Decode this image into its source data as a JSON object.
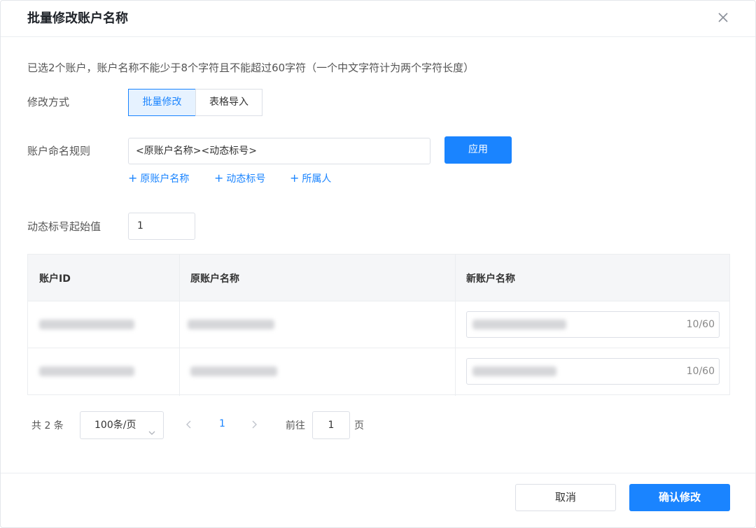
{
  "dialog": {
    "title": "批量修改账户名称",
    "close_icon": "close-icon"
  },
  "description": "已选2个账户，账户名称不能少于8个字符且不能超过60字符（一个中文字符计为两个字符长度）",
  "modify_mode": {
    "label": "修改方式",
    "options": [
      "批量修改",
      "表格导入"
    ],
    "selected": "批量修改"
  },
  "naming_rule": {
    "label": "账户命名规则",
    "value": "<原账户名称><动态标号>",
    "apply_label": "应用",
    "add_links": [
      {
        "plus": "+",
        "label": "原账户名称"
      },
      {
        "plus": "+",
        "label": "动态标号"
      },
      {
        "plus": "+",
        "label": "所属人"
      }
    ]
  },
  "start_value": {
    "label": "动态标号起始值",
    "value": "1"
  },
  "table": {
    "columns": [
      "账户ID",
      "原账户名称",
      "新账户名称"
    ],
    "rows": [
      {
        "new_name_count": "10/60"
      },
      {
        "new_name_count": "10/60"
      }
    ]
  },
  "pagination": {
    "total_text": "共 2 条",
    "page_size": "100条/页",
    "current_page": "1",
    "goto_label": "前往",
    "goto_value": "1",
    "page_suffix": "页"
  },
  "footer": {
    "cancel_label": "取消",
    "confirm_label": "确认修改"
  },
  "colors": {
    "primary": "#1a84ff",
    "border": "#dcdfe6",
    "header_bg": "#f5f6f8"
  }
}
